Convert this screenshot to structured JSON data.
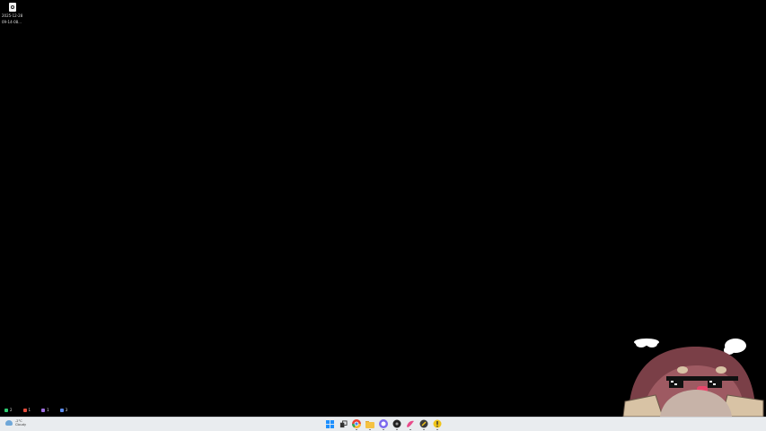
{
  "desktop": {
    "file_icon": {
      "icon": "file-icon",
      "label_line1": "2025-12-28",
      "label_line2": "09-14-08..."
    },
    "counters": [
      {
        "icon": "green-app-icon",
        "color": "#2ecc71",
        "value": "2"
      },
      {
        "icon": "red-app-icon",
        "color": "#e74c3c",
        "value": "1"
      },
      {
        "icon": "purple-app-icon",
        "color": "#a070e0",
        "value": "1"
      },
      {
        "icon": "blue-app-icon",
        "color": "#5b8def",
        "value": "3"
      }
    ]
  },
  "taskbar": {
    "weather": {
      "temp": "-2°C",
      "condition": "Cloudy"
    },
    "apps": [
      {
        "name": "start-button",
        "icon": "windows-logo-icon",
        "color": "#1e90ff"
      },
      {
        "name": "taskview",
        "icon": "task-view-icon",
        "color": "#333333"
      },
      {
        "name": "chrome",
        "icon": "chrome-icon",
        "color": "#e94235"
      },
      {
        "name": "file-explorer",
        "icon": "folder-icon",
        "color": "#f5c242"
      },
      {
        "name": "messenger",
        "icon": "chat-bubble-icon",
        "color": "#7b68ee"
      },
      {
        "name": "terminal",
        "icon": "circle-dark-icon",
        "color": "#222222"
      },
      {
        "name": "bird-app",
        "icon": "bird-icon",
        "color": "#e84b8a"
      },
      {
        "name": "pen-app",
        "icon": "pen-icon",
        "color": "#555555"
      },
      {
        "name": "alert-app",
        "icon": "exclamation-icon",
        "color": "#f0c419"
      }
    ]
  }
}
